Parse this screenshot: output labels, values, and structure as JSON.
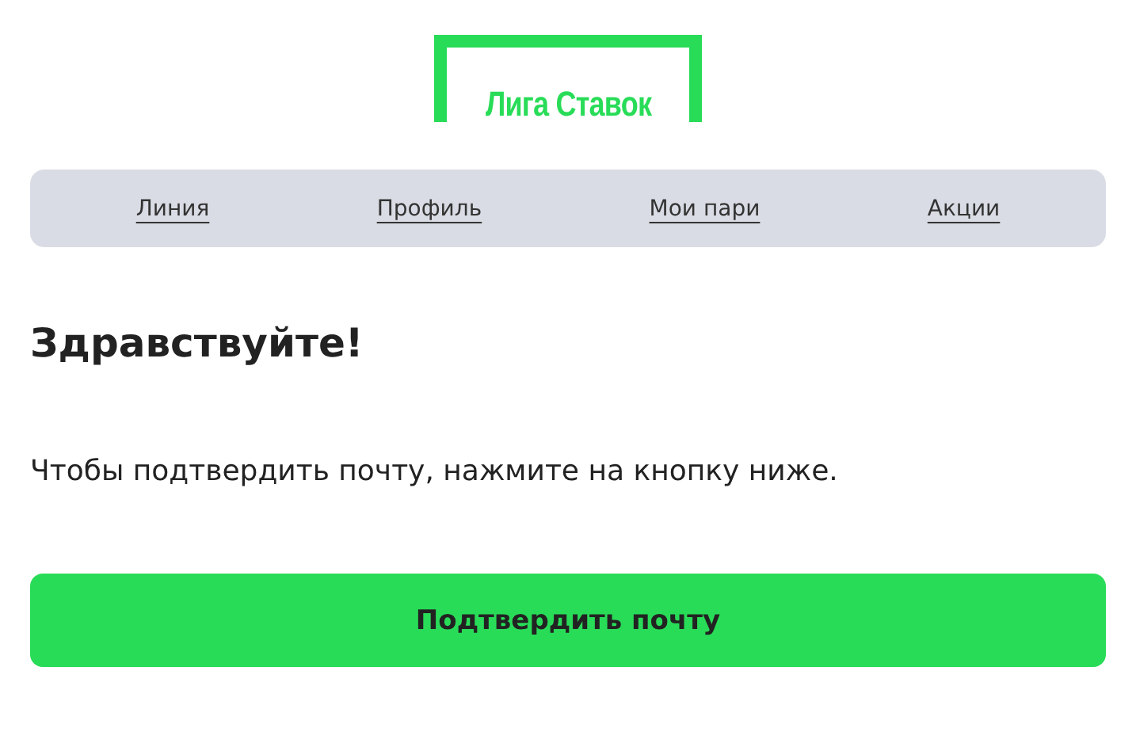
{
  "logo": {
    "text": "Лига Ставок"
  },
  "nav": [
    {
      "label": "Линия"
    },
    {
      "label": "Профиль"
    },
    {
      "label": "Мои пари"
    },
    {
      "label": "Акции"
    }
  ],
  "heading": "Здравствуйте!",
  "message": "Чтобы подтвердить почту, нажмите на кнопку ниже.",
  "button": "Подтвердить почту"
}
